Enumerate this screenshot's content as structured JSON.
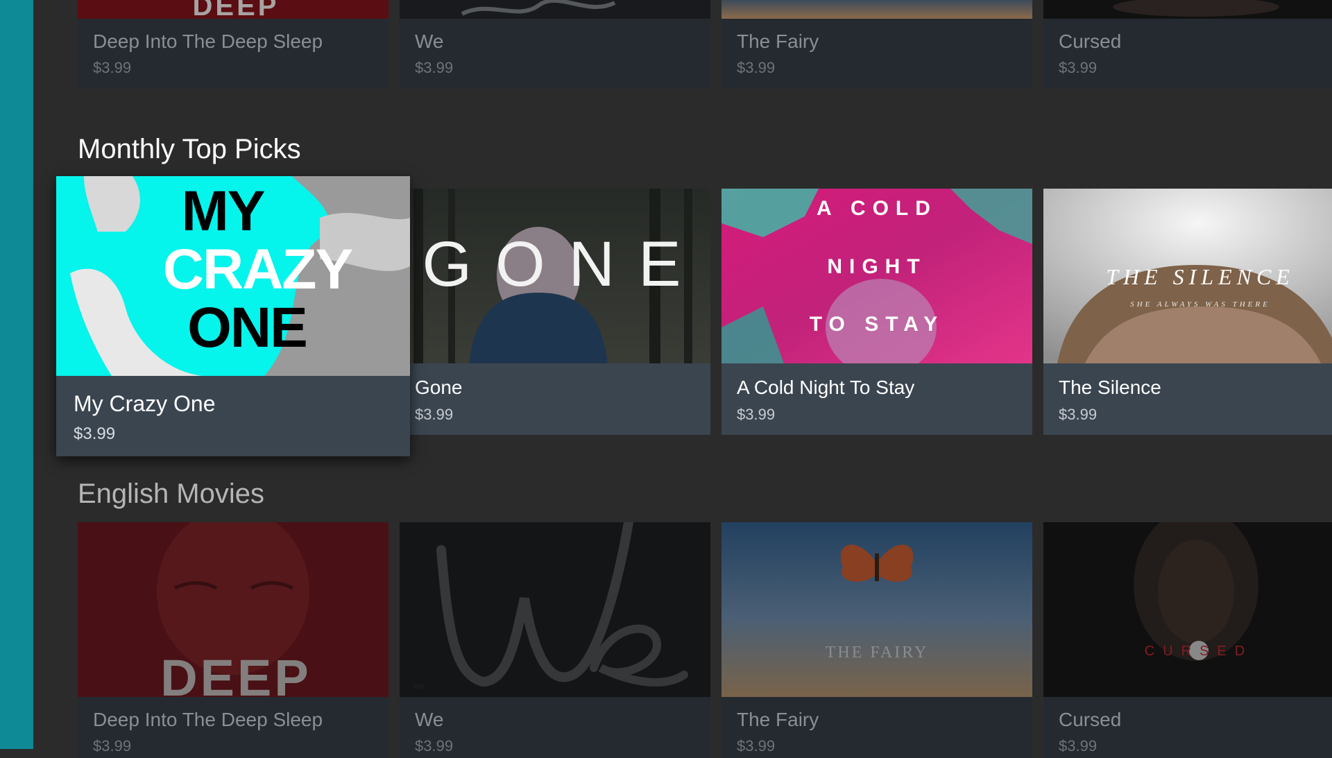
{
  "rows": [
    {
      "title": "",
      "items": [
        {
          "title": "Deep Into The Deep Sleep",
          "price": "$3.99",
          "poster_text": "DEEP"
        },
        {
          "title": "We",
          "price": "$3.99",
          "poster_text": "We"
        },
        {
          "title": "The Fairy",
          "price": "$3.99",
          "poster_text": ""
        },
        {
          "title": "Cursed",
          "price": "$3.99",
          "poster_text": ""
        }
      ]
    },
    {
      "title": "Monthly Top Picks",
      "items": [
        {
          "title": "My Crazy One",
          "price": "$3.99",
          "poster_lines": [
            "MY",
            "CRAZY",
            "ONE"
          ]
        },
        {
          "title": "Gone",
          "price": "$3.99",
          "poster_text": "GONE"
        },
        {
          "title": "A Cold Night To Stay",
          "price": "$3.99",
          "poster_lines": [
            "A COLD",
            "NIGHT",
            "TO STAY"
          ]
        },
        {
          "title": "The Silence",
          "price": "$3.99",
          "poster_text": "THE SILENCE",
          "poster_tagline": "SHE ALWAYS WAS THERE"
        }
      ]
    },
    {
      "title": "English Movies",
      "items": [
        {
          "title": "Deep Into The Deep Sleep",
          "price": "$3.99",
          "poster_text": "DEEP"
        },
        {
          "title": "We",
          "price": "$3.99",
          "poster_text": "We"
        },
        {
          "title": "The Fairy",
          "price": "$3.99",
          "poster_text": "THE FAIRY"
        },
        {
          "title": "Cursed",
          "price": "$3.99",
          "poster_text": "CURSED"
        }
      ]
    }
  ],
  "colors": {
    "side_rail": "#0e8a96",
    "background": "#2b2b2b",
    "card_info": "#3b4550"
  }
}
